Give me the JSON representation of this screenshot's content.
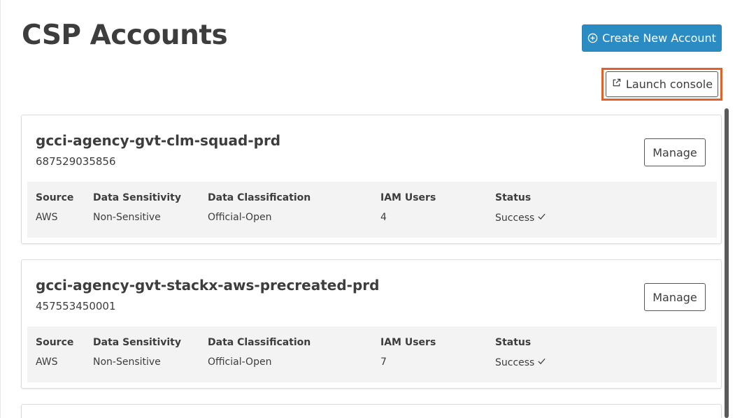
{
  "header": {
    "title": "CSP Accounts",
    "create_button_label": "Create New Account",
    "launch_console_label": "Launch console"
  },
  "colors": {
    "primary_button": "#2b8cc4",
    "highlight_outline": "#e2612a",
    "detail_panel": "#f3f3f3"
  },
  "icons": {
    "create": "plus-circle-icon",
    "launch": "external-link-icon",
    "status_ok": "checkmark-icon"
  },
  "columns": [
    "Source",
    "Data Sensitivity",
    "Data Classification",
    "IAM Users",
    "Status"
  ],
  "accounts": [
    {
      "name": "gcci-agency-gvt-clm-squad-prd",
      "id": "687529035856",
      "manage_label": "Manage",
      "source": "AWS",
      "sensitivity": "Non-Sensitive",
      "classification": "Official-Open",
      "iam_users": "4",
      "status": "Success"
    },
    {
      "name": "gcci-agency-gvt-stackx-aws-precreated-prd",
      "id": "457553450001",
      "manage_label": "Manage",
      "source": "AWS",
      "sensitivity": "Non-Sensitive",
      "classification": "Official-Open",
      "iam_users": "7",
      "status": "Success"
    }
  ]
}
